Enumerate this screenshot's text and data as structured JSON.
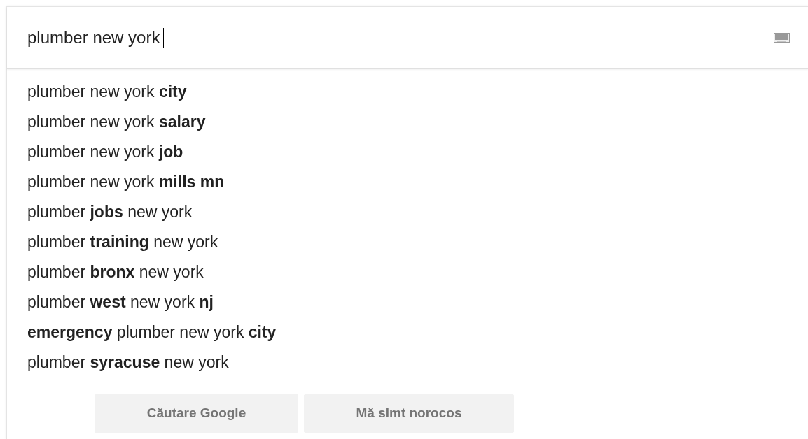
{
  "search": {
    "value": "plumber new york"
  },
  "suggestions": [
    "plumber new york **city**",
    "plumber new york **salary**",
    "plumber new york **job**",
    "plumber new york **mills mn**",
    "plumber **jobs** new york",
    "plumber **training** new york",
    "plumber **bronx** new york",
    "plumber **west** new york **nj**",
    "**emergency** plumber new york **city**",
    "plumber **syracuse** new york"
  ],
  "buttons": [
    "Căutare Google",
    "Mă simt norocos"
  ]
}
